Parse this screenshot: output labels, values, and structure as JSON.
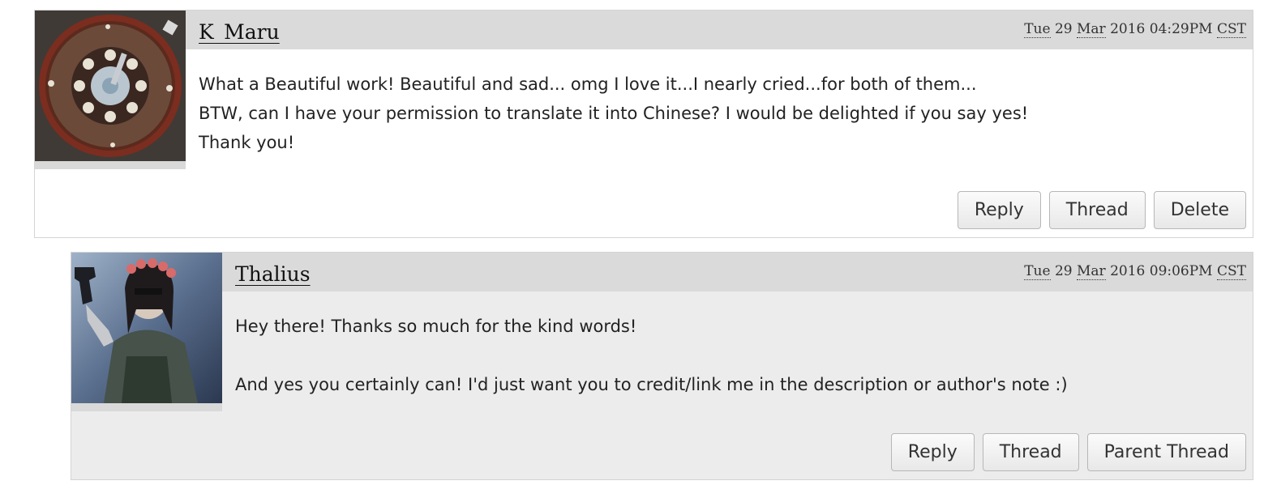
{
  "comments": [
    {
      "username": "K_Maru",
      "date": {
        "day_name": "Tue",
        "day": "29",
        "month": "Mar",
        "year": "2016",
        "time": "04:29PM",
        "tz": "CST"
      },
      "body": [
        "What a Beautiful work! Beautiful and sad... omg I love it...I nearly cried...for both of them...",
        "BTW, can I have your permission to translate it into Chinese? I would be delighted if you say yes!",
        "Thank you!"
      ],
      "actions": [
        "Reply",
        "Thread",
        "Delete"
      ]
    },
    {
      "username": "Thalius",
      "date": {
        "day_name": "Tue",
        "day": "29",
        "month": "Mar",
        "year": "2016",
        "time": "09:06PM",
        "tz": "CST"
      },
      "body": [
        "Hey there! Thanks so much for the kind words!",
        "",
        "And yes you certainly can! I'd just want you to credit/link me in the description or author's note :)"
      ],
      "actions": [
        "Reply",
        "Thread",
        "Parent Thread"
      ]
    }
  ]
}
